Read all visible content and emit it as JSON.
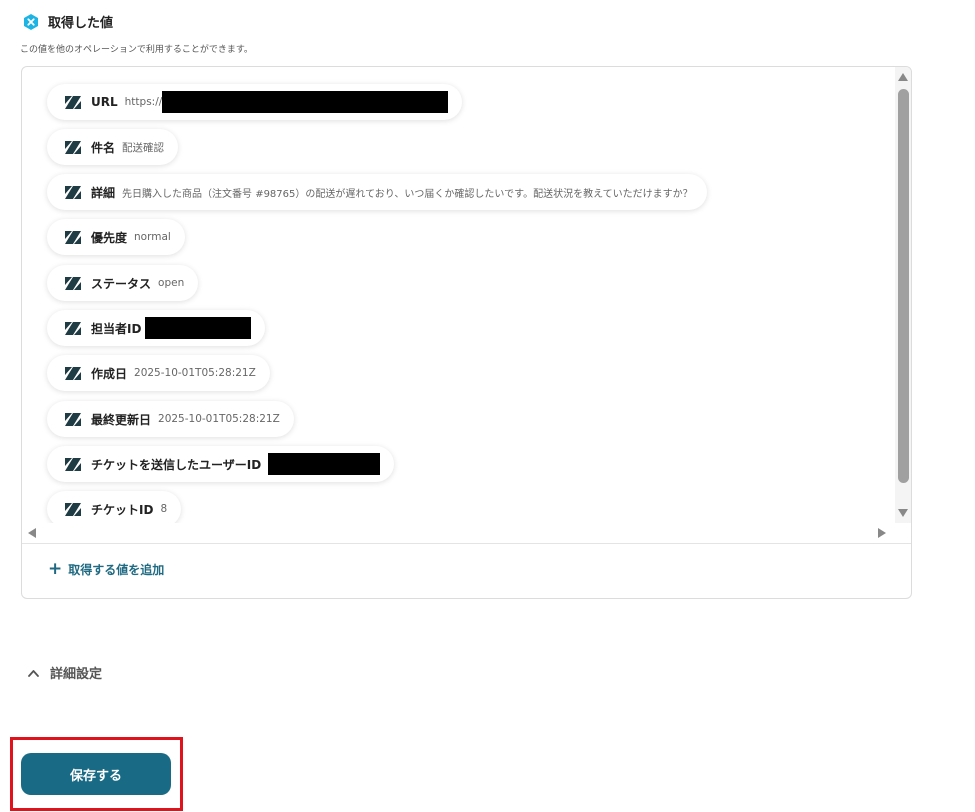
{
  "header": {
    "title": "取得した値",
    "description": "この値を他のオペレーションで利用することができます。",
    "icon": "hex-x-icon",
    "icon_color": "#1db4e3"
  },
  "fields": [
    {
      "key": "URL",
      "value": "https://",
      "redacted": true
    },
    {
      "key": "件名",
      "value": "配送確認"
    },
    {
      "key": "詳細",
      "value": "先日購入した商品（注文番号 #98765）の配送が遅れており、いつ届くか確認したいです。配送状況を教えていただけますか？"
    },
    {
      "key": "優先度",
      "value": "normal"
    },
    {
      "key": "ステータス",
      "value": "open"
    },
    {
      "key": "担当者ID",
      "value": "",
      "redacted": true
    },
    {
      "key": "作成日",
      "value": "2025-10-01T05:28:21Z"
    },
    {
      "key": "最終更新日",
      "value": "2025-10-01T05:28:21Z"
    },
    {
      "key": "チケットを送信したユーザーID",
      "value": "",
      "redacted": true
    },
    {
      "key": "チケットID",
      "value": "8"
    }
  ],
  "field_icon": "zendesk-icon",
  "add_value_label": "取得する値を追加",
  "advanced_label": "詳細設定",
  "save_label": "保存する",
  "colors": {
    "accent": "#186a85",
    "highlight": "#e0121c"
  }
}
